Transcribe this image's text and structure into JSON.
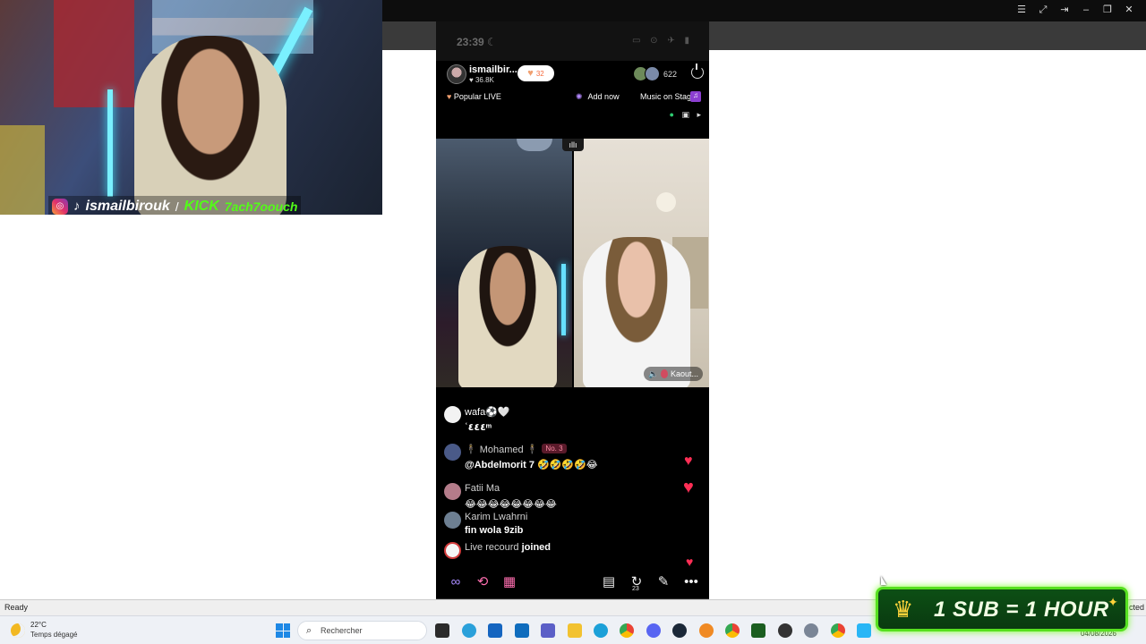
{
  "window": {
    "controls": [
      "☰",
      "⤢",
      "⇥",
      "–",
      "❐",
      "✕"
    ]
  },
  "webcam": {
    "handle": "ismailbirouk",
    "kick_label": "KICK",
    "kick_user": "7ach7oouch",
    "icons": [
      "instagram-icon",
      "tiktok-icon"
    ]
  },
  "phone": {
    "status": {
      "time": "23:39",
      "moon": "☾"
    },
    "live": {
      "host_name": "ismailbir...",
      "host_likes": "♥ 36.8K",
      "follow_heart": "♥",
      "follow_count": "32",
      "viewer_count": "622",
      "popular_live": "Popular LIVE",
      "add_now": "Add now",
      "music_on_stage": "Music on Stag",
      "guest_tag": "Kaout..."
    },
    "comments": [
      {
        "name": "wafa⚽🤍",
        "text": "ʿ٤٤٤ ͫ"
      },
      {
        "name": "🕴 Mohamed 🕴",
        "badge": "No. 3",
        "text": "@Abdelmorit 7 🤣🤣🤣🤣😂"
      },
      {
        "name": "Fatii Ma",
        "text": "😂😂😂😂😂😂😂😂"
      },
      {
        "name": "Karim Lwahrni",
        "text": "fin wola 9zib"
      },
      {
        "name": "Live recourd",
        "action": "joined"
      }
    ],
    "bottom_badge": "23"
  },
  "status_bar": {
    "ready": "Ready",
    "connection_suffix": "cted"
  },
  "taskbar": {
    "temperature": "22°C",
    "weather": "Temps dégagé",
    "search_placeholder": "Rechercher",
    "date": "04/08/2026"
  },
  "overlay": {
    "sub_banner": "1 SUB = 1 HOUR"
  },
  "colors": {
    "heart": "#ff2e55",
    "kick_green": "#53fc18",
    "banner_border": "#56e01f"
  }
}
